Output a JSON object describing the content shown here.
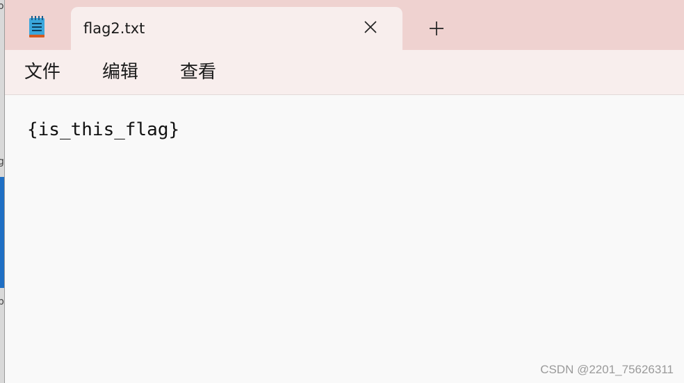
{
  "tab": {
    "title": "flag2.txt"
  },
  "menu": {
    "items": [
      "文件",
      "编辑",
      "查看"
    ]
  },
  "editor": {
    "content": "{is_this_flag}"
  },
  "watermark": "CSDN @2201_75626311",
  "behind_window": {
    "fragments": [
      "o",
      "g",
      "p"
    ]
  },
  "icons": {
    "app": "notepad-icon",
    "close": "close-icon",
    "add": "plus-icon"
  },
  "colors": {
    "titlebar": "#efd2d0",
    "tab": "#f8eeed",
    "editor_bg": "#f9f9f9",
    "icon_accent": "#2a9fd6"
  }
}
